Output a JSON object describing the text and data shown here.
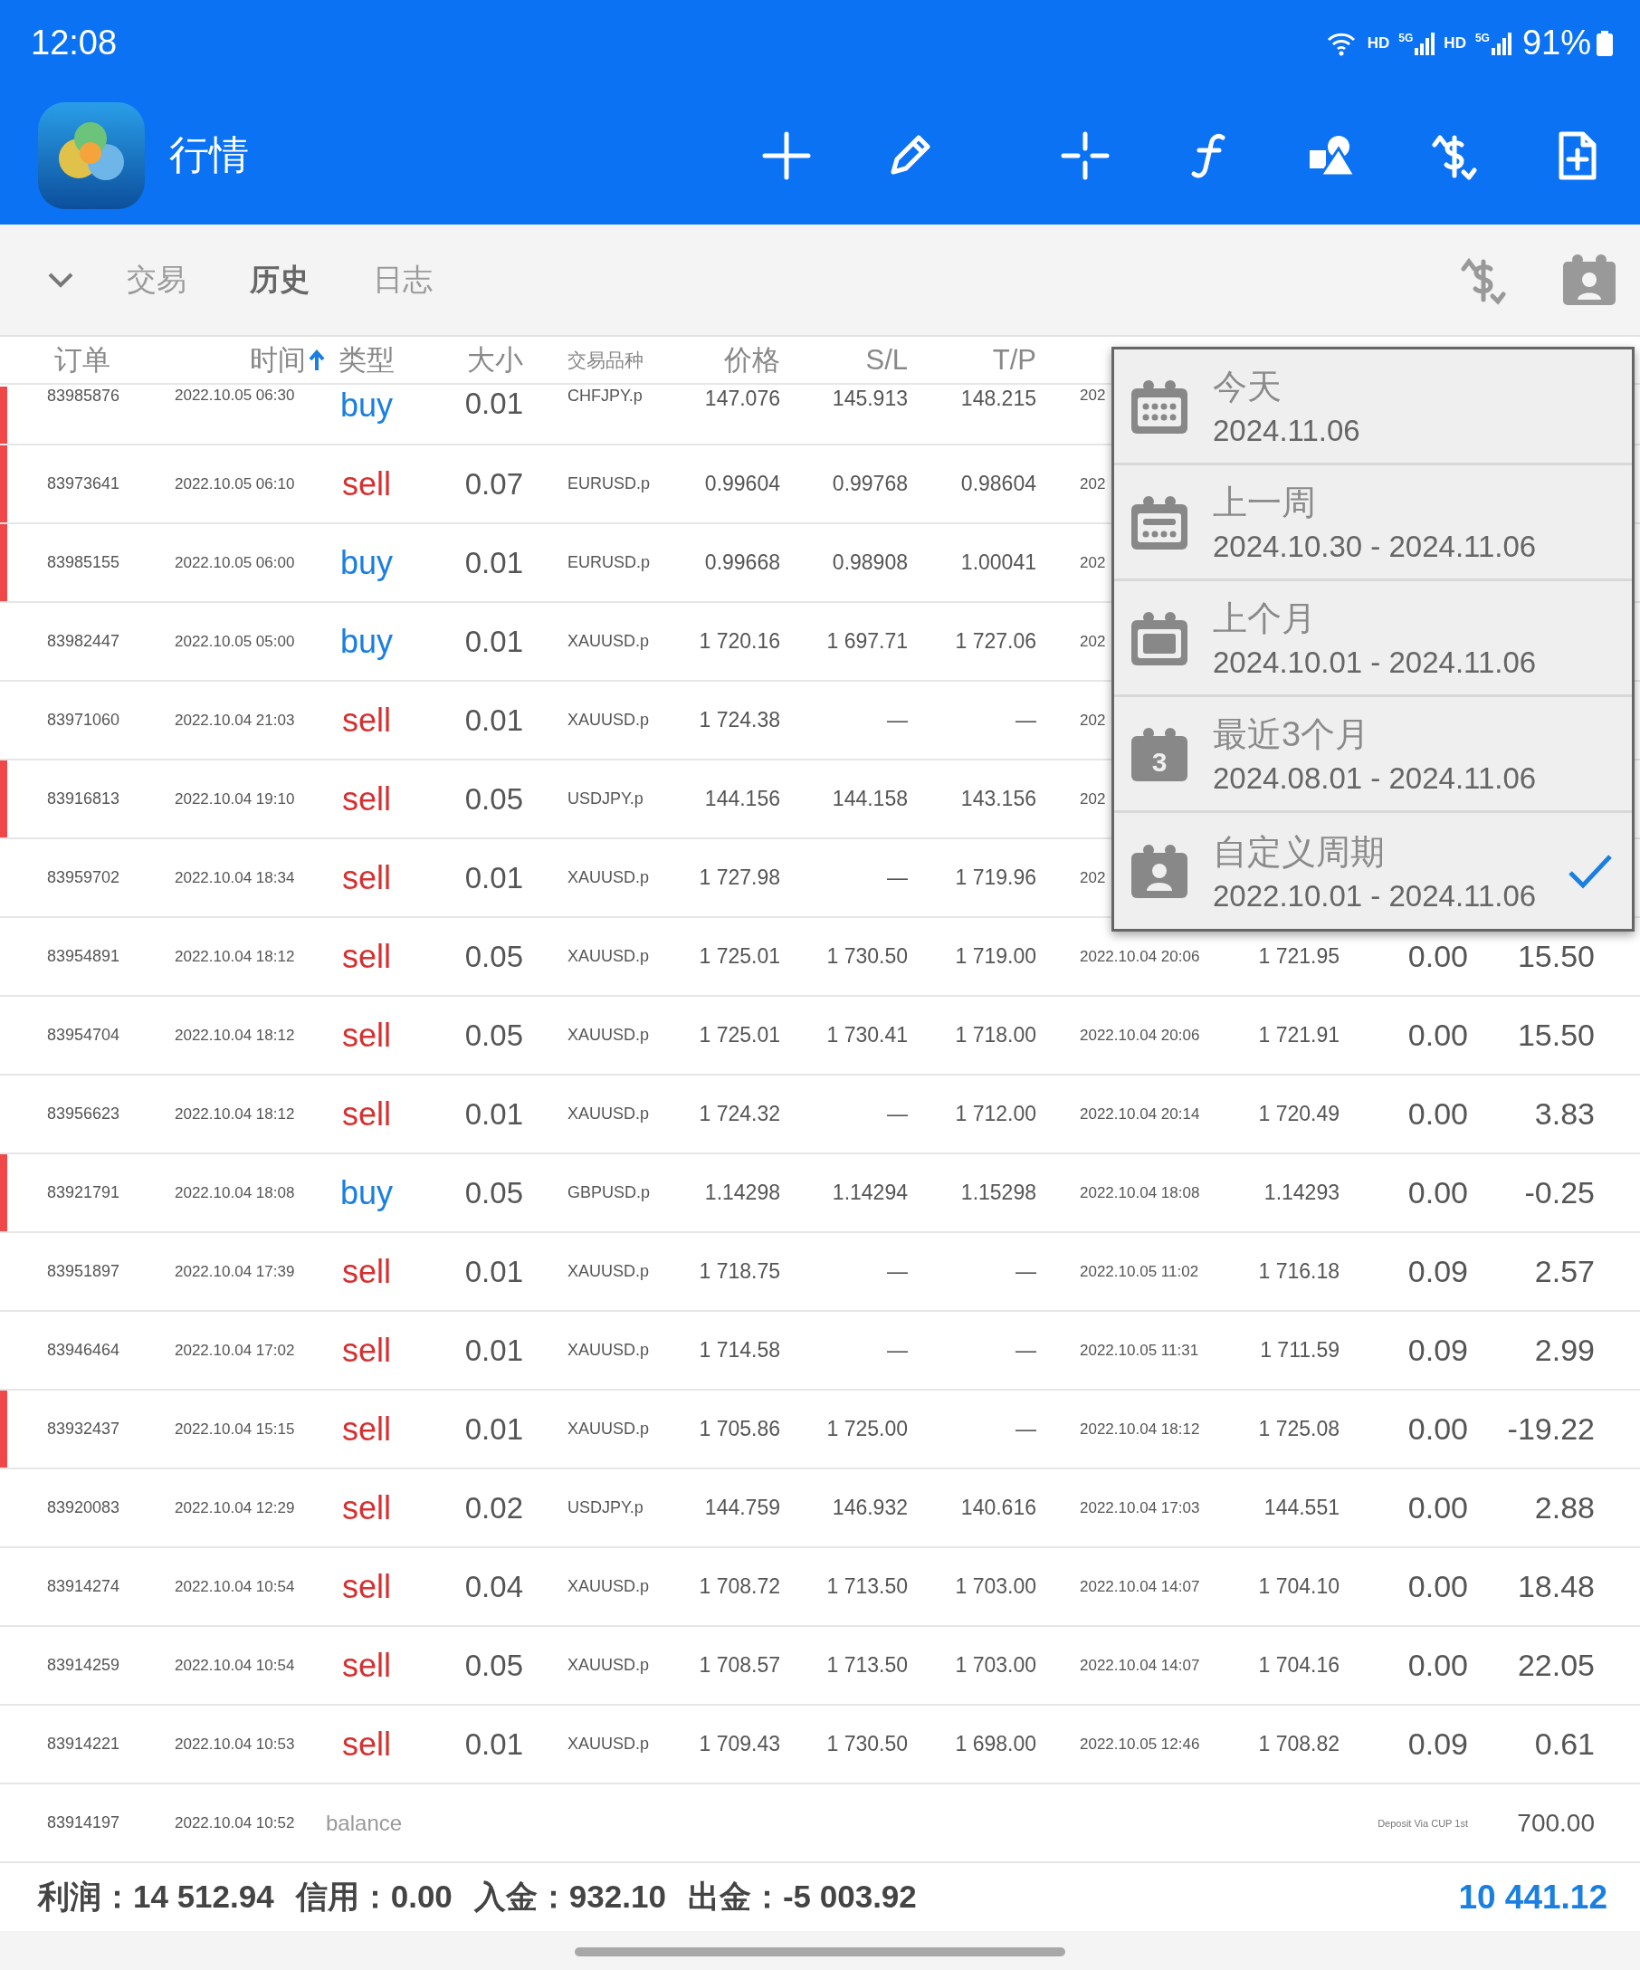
{
  "status_bar": {
    "time": "12:08",
    "networks": [
      {
        "label": "HD",
        "generation": "5G"
      },
      {
        "label": "HD",
        "generation": "5G"
      }
    ],
    "battery": "91%"
  },
  "app_bar": {
    "title": "行情"
  },
  "tabs": [
    {
      "label": "交易",
      "selected": false
    },
    {
      "label": "历史",
      "selected": true
    },
    {
      "label": "日志",
      "selected": false
    }
  ],
  "table": {
    "columns": [
      {
        "label": "订单",
        "sorted": false
      },
      {
        "label": "时间",
        "sorted": true
      },
      {
        "label": "类型",
        "sorted": false
      },
      {
        "label": "大小",
        "sorted": false
      },
      {
        "label": "交易品种",
        "sorted": false
      },
      {
        "label": "价格",
        "sorted": false
      },
      {
        "label": "S/L",
        "sorted": false
      },
      {
        "label": "T/P",
        "sorted": false
      }
    ],
    "rows": [
      {
        "kind": "buy",
        "marked": true,
        "order": "83985876",
        "time": "2022.10.05 06:30",
        "type": "buy",
        "size": "0.01",
        "symbol": "CHFJPY.p",
        "price": "147.076",
        "sl": "145.913",
        "tp": "148.215",
        "close_time": "202"
      },
      {
        "kind": "sell",
        "marked": true,
        "order": "83973641",
        "time": "2022.10.05 06:10",
        "type": "sell",
        "size": "0.07",
        "symbol": "EURUSD.p",
        "price": "0.99604",
        "sl": "0.99768",
        "tp": "0.98604",
        "close_time": "202"
      },
      {
        "kind": "buy",
        "marked": true,
        "order": "83985155",
        "time": "2022.10.05 06:00",
        "type": "buy",
        "size": "0.01",
        "symbol": "EURUSD.p",
        "price": "0.99668",
        "sl": "0.98908",
        "tp": "1.00041",
        "close_time": "202"
      },
      {
        "kind": "buy",
        "marked": false,
        "order": "83982447",
        "time": "2022.10.05 05:00",
        "type": "buy",
        "size": "0.01",
        "symbol": "XAUUSD.p",
        "price": "1 720.16",
        "sl": "1 697.71",
        "tp": "1 727.06",
        "close_time": "202"
      },
      {
        "kind": "sell",
        "marked": false,
        "order": "83971060",
        "time": "2022.10.04 21:03",
        "type": "sell",
        "size": "0.01",
        "symbol": "XAUUSD.p",
        "price": "1 724.38",
        "sl": "—",
        "tp": "—",
        "close_time": "202"
      },
      {
        "kind": "sell",
        "marked": true,
        "order": "83916813",
        "time": "2022.10.04 19:10",
        "type": "sell",
        "size": "0.05",
        "symbol": "USDJPY.p",
        "price": "144.156",
        "sl": "144.158",
        "tp": "143.156",
        "close_time": "202"
      },
      {
        "kind": "sell",
        "marked": false,
        "order": "83959702",
        "time": "2022.10.04 18:34",
        "type": "sell",
        "size": "0.01",
        "symbol": "XAUUSD.p",
        "price": "1 727.98",
        "sl": "—",
        "tp": "1 719.96",
        "close_time": "202"
      },
      {
        "kind": "sell",
        "marked": false,
        "order": "83954891",
        "time": "2022.10.04 18:12",
        "type": "sell",
        "size": "0.05",
        "symbol": "XAUUSD.p",
        "price": "1 725.01",
        "sl": "1 730.50",
        "tp": "1 719.00",
        "close_time": "2022.10.04 20:06",
        "close_price": "1 721.95",
        "swap": "0.00",
        "profit": "15.50"
      },
      {
        "kind": "sell",
        "marked": false,
        "order": "83954704",
        "time": "2022.10.04 18:12",
        "type": "sell",
        "size": "0.05",
        "symbol": "XAUUSD.p",
        "price": "1 725.01",
        "sl": "1 730.41",
        "tp": "1 718.00",
        "close_time": "2022.10.04 20:06",
        "close_price": "1 721.91",
        "swap": "0.00",
        "profit": "15.50"
      },
      {
        "kind": "sell",
        "marked": false,
        "order": "83956623",
        "time": "2022.10.04 18:12",
        "type": "sell",
        "size": "0.01",
        "symbol": "XAUUSD.p",
        "price": "1 724.32",
        "sl": "—",
        "tp": "1 712.00",
        "close_time": "2022.10.04 20:14",
        "close_price": "1 720.49",
        "swap": "0.00",
        "profit": "3.83"
      },
      {
        "kind": "buy",
        "marked": true,
        "order": "83921791",
        "time": "2022.10.04 18:08",
        "type": "buy",
        "size": "0.05",
        "symbol": "GBPUSD.p",
        "price": "1.14298",
        "sl": "1.14294",
        "tp": "1.15298",
        "close_time": "2022.10.04 18:08",
        "close_price": "1.14293",
        "swap": "0.00",
        "profit": "-0.25"
      },
      {
        "kind": "sell",
        "marked": false,
        "order": "83951897",
        "time": "2022.10.04 17:39",
        "type": "sell",
        "size": "0.01",
        "symbol": "XAUUSD.p",
        "price": "1 718.75",
        "sl": "—",
        "tp": "—",
        "close_time": "2022.10.05 11:02",
        "close_price": "1 716.18",
        "swap": "0.09",
        "profit": "2.57"
      },
      {
        "kind": "sell",
        "marked": false,
        "order": "83946464",
        "time": "2022.10.04 17:02",
        "type": "sell",
        "size": "0.01",
        "symbol": "XAUUSD.p",
        "price": "1 714.58",
        "sl": "—",
        "tp": "—",
        "close_time": "2022.10.05 11:31",
        "close_price": "1 711.59",
        "swap": "0.09",
        "profit": "2.99"
      },
      {
        "kind": "sell",
        "marked": true,
        "order": "83932437",
        "time": "2022.10.04 15:15",
        "type": "sell",
        "size": "0.01",
        "symbol": "XAUUSD.p",
        "price": "1 705.86",
        "sl": "1 725.00",
        "tp": "—",
        "close_time": "2022.10.04 18:12",
        "close_price": "1 725.08",
        "swap": "0.00",
        "profit": "-19.22"
      },
      {
        "kind": "sell",
        "marked": false,
        "order": "83920083",
        "time": "2022.10.04 12:29",
        "type": "sell",
        "size": "0.02",
        "symbol": "USDJPY.p",
        "price": "144.759",
        "sl": "146.932",
        "tp": "140.616",
        "close_time": "2022.10.04 17:03",
        "close_price": "144.551",
        "swap": "0.00",
        "profit": "2.88"
      },
      {
        "kind": "sell",
        "marked": false,
        "order": "83914274",
        "time": "2022.10.04 10:54",
        "type": "sell",
        "size": "0.04",
        "symbol": "XAUUSD.p",
        "price": "1 708.72",
        "sl": "1 713.50",
        "tp": "1 703.00",
        "close_time": "2022.10.04 14:07",
        "close_price": "1 704.10",
        "swap": "0.00",
        "profit": "18.48"
      },
      {
        "kind": "sell",
        "marked": false,
        "order": "83914259",
        "time": "2022.10.04 10:54",
        "type": "sell",
        "size": "0.05",
        "symbol": "XAUUSD.p",
        "price": "1 708.57",
        "sl": "1 713.50",
        "tp": "1 703.00",
        "close_time": "2022.10.04 14:07",
        "close_price": "1 704.16",
        "swap": "0.00",
        "profit": "22.05"
      },
      {
        "kind": "sell",
        "marked": false,
        "order": "83914221",
        "time": "2022.10.04 10:53",
        "type": "sell",
        "size": "0.01",
        "symbol": "XAUUSD.p",
        "price": "1 709.43",
        "sl": "1 730.50",
        "tp": "1 698.00",
        "close_time": "2022.10.05 12:46",
        "close_price": "1 708.82",
        "swap": "0.09",
        "profit": "0.61"
      },
      {
        "kind": "balance",
        "marked": false,
        "order": "83914197",
        "time": "2022.10.04 10:52",
        "type": "balance",
        "comment": "Deposit Via CUP 1st",
        "profit": "700.00"
      }
    ]
  },
  "period_menu": {
    "items": [
      {
        "kind": "day",
        "title": "今天",
        "range": "2024.11.06",
        "selected": false
      },
      {
        "kind": "week",
        "title": "上一周",
        "range": "2024.10.30 - 2024.11.06",
        "selected": false
      },
      {
        "kind": "month",
        "title": "上个月",
        "range": "2024.10.01 - 2024.11.06",
        "selected": false
      },
      {
        "kind": "number",
        "icon_text": "3",
        "title": "最近3个月",
        "range": "2024.08.01 - 2024.11.06",
        "selected": false
      },
      {
        "kind": "custom",
        "title": "自定义周期",
        "range": "2022.10.01 - 2024.11.06",
        "selected": true
      }
    ]
  },
  "summary": {
    "items": [
      "利润：14 512.94",
      "信用：0.00",
      "入金：932.10",
      "出金：-5 003.92"
    ],
    "total": "10 441.12"
  }
}
